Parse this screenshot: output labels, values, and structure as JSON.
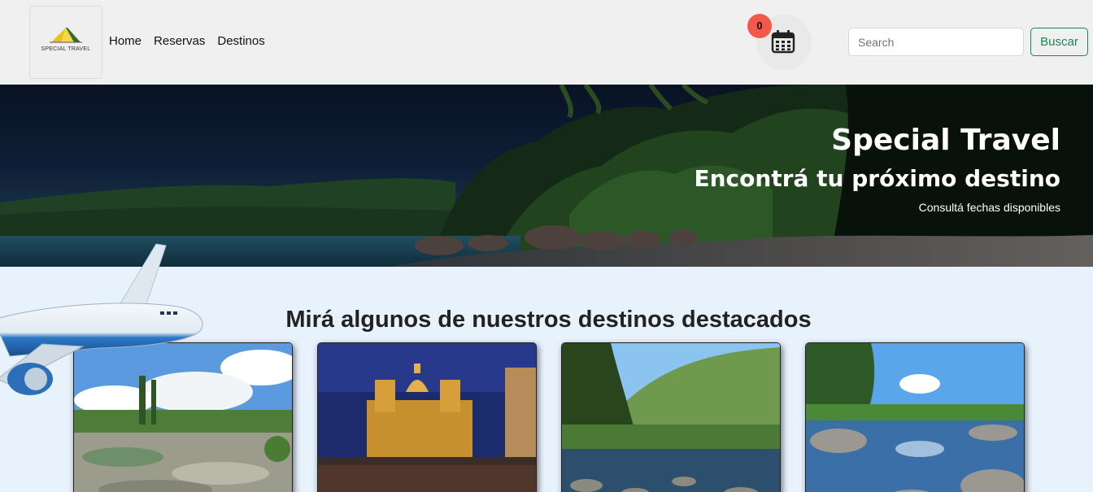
{
  "brand": {
    "logo_text": "SPECIAL TRAVEL"
  },
  "nav": {
    "items": [
      {
        "label": "Home"
      },
      {
        "label": "Reservas"
      },
      {
        "label": "Destinos"
      }
    ]
  },
  "calendar": {
    "count": "0",
    "icon": "calendar-icon"
  },
  "search": {
    "placeholder": "Search",
    "value": "",
    "button_label": "Buscar"
  },
  "hero": {
    "title": "Special Travel",
    "subtitle": "Encontrá tu próximo destino",
    "small_text": "Consultá fechas disponibles"
  },
  "featured": {
    "title": "Mirá algunos de nuestros destinos destacados"
  },
  "colors": {
    "navbar_bg": "#f0f0f0",
    "page_bg": "#e8f2fd",
    "accent_green": "#198754",
    "badge_red": "#f4584a"
  }
}
